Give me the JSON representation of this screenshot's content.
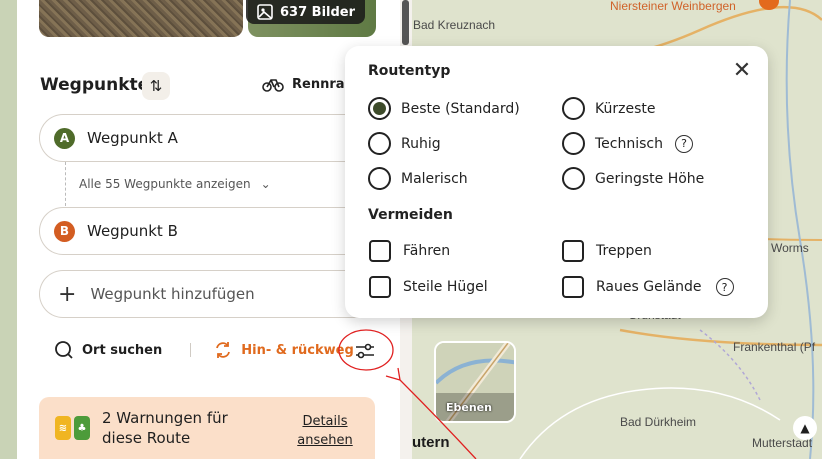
{
  "map": {
    "labels": {
      "bad_kreuznach": "Bad Kreuznach",
      "niersteiner": "Niersteiner Weinbergen",
      "worms": "Worms",
      "frankenthal": "Frankenthal (Pf",
      "bad_duerkheim": "Bad Dürkheim",
      "gruenstadt": "Grünstadt",
      "mutterstadt": "Mutterstadt",
      "kaiserslautern_partial": "utern"
    },
    "terrain_label": "Ebenen"
  },
  "photos": {
    "count_label": "637 Bilder"
  },
  "waypoints": {
    "title": "Wegpunkte",
    "sport_label": "Rennrad",
    "start": {
      "badge": "A",
      "label": "Wegpunkt A"
    },
    "show_all": "Alle 55 Wegpunkte anzeigen",
    "end": {
      "badge": "B",
      "label": "Wegpunkt B"
    },
    "add_placeholder": "Wegpunkt hinzufügen"
  },
  "toolbar": {
    "search_label": "Ort suchen",
    "roundtrip_label": "Hin- & rückweg"
  },
  "warnings": {
    "text": "2 Warnungen für diese Route",
    "link": "Details ansehen"
  },
  "popup": {
    "route_type_title": "Routentyp",
    "route_types": [
      {
        "label": "Beste (Standard)",
        "checked": true
      },
      {
        "label": "Kürzeste",
        "checked": false
      },
      {
        "label": "Ruhig",
        "checked": false
      },
      {
        "label": "Technisch",
        "checked": false,
        "help": true
      },
      {
        "label": "Malerisch",
        "checked": false
      },
      {
        "label": "Geringste Höhe",
        "checked": false
      }
    ],
    "avoid_title": "Vermeiden",
    "avoid": [
      {
        "label": "Fähren",
        "checked": false
      },
      {
        "label": "Treppen",
        "checked": false
      },
      {
        "label": "Steile Hügel",
        "checked": false
      },
      {
        "label": "Raues Gelände",
        "checked": false,
        "help": true
      }
    ],
    "help_glyph": "?"
  },
  "colors": {
    "accent_orange": "#e06a1e",
    "badge_green": "#4f6b2a",
    "badge_orange": "#d35d22",
    "warning_bg": "#fbdfc9",
    "annotation_red": "#e02020"
  }
}
